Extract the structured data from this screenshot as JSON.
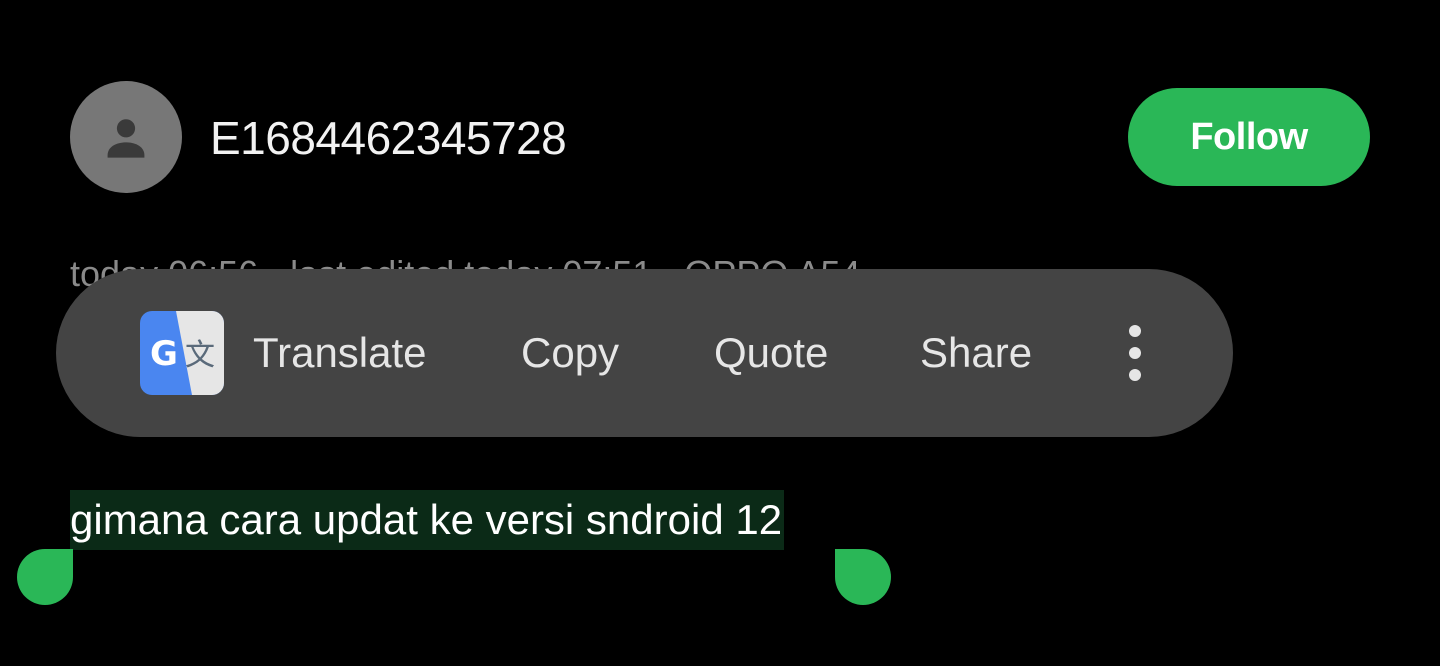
{
  "profile": {
    "avatar_icon": "person-icon",
    "username": "E1684462345728",
    "follow_label": "Follow"
  },
  "post": {
    "meta": "today 06:56 · last edited today 07:51 · OPPO A54",
    "text": "gimana cara updat ke versi sndroid 12"
  },
  "context_menu": {
    "app_icon": "google-translate-icon",
    "items": [
      "Translate",
      "Copy",
      "Quote",
      "Share"
    ],
    "more_icon": "more-vertical-icon"
  },
  "colors": {
    "accent": "#2ab757",
    "menu_bg": "#444444",
    "selection_bg": "#0b2a17",
    "background": "#000000"
  }
}
